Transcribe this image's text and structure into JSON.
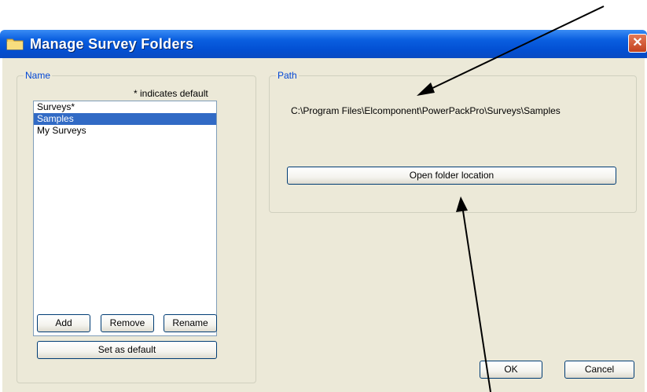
{
  "window": {
    "title": "Manage Survey Folders",
    "icon": "folder-icon",
    "close_glyph": "✕"
  },
  "name_group": {
    "legend": "Name",
    "hint": "* indicates default",
    "items": [
      {
        "label": "Surveys*",
        "selected": false
      },
      {
        "label": "Samples",
        "selected": true
      },
      {
        "label": "My Surveys",
        "selected": false
      }
    ],
    "add_label": "Add",
    "remove_label": "Remove",
    "rename_label": "Rename",
    "set_default_label": "Set as default"
  },
  "path_group": {
    "legend": "Path",
    "path": "C:\\Program Files\\Elcomponent\\PowerPackPro\\Surveys\\Samples",
    "open_label": "Open folder location"
  },
  "footer": {
    "ok_label": "OK",
    "cancel_label": "Cancel"
  },
  "colors": {
    "titlebar": "#0a5fe0",
    "client": "#ece9d8",
    "selection": "#316ac5",
    "group_legend": "#0046d5",
    "close": "#c2421e"
  }
}
